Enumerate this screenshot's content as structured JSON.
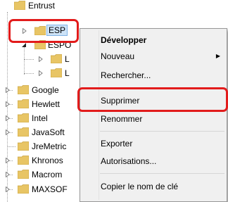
{
  "tree": {
    "nodes": [
      {
        "label": "Entrust"
      },
      {
        "label": "ESP"
      },
      {
        "label": "ESPO"
      },
      {
        "label": "L"
      },
      {
        "label": "L"
      },
      {
        "label": "Google"
      },
      {
        "label": "Hewlett"
      },
      {
        "label": "Intel"
      },
      {
        "label": "JavaSoft"
      },
      {
        "label": "JreMetric"
      },
      {
        "label": "Khronos"
      },
      {
        "label": "Macrom"
      },
      {
        "label": "MAXSOF"
      }
    ]
  },
  "context_menu": {
    "items": [
      {
        "label": "Développer"
      },
      {
        "label": "Nouveau"
      },
      {
        "label": "Rechercher..."
      },
      {
        "label": "Supprimer"
      },
      {
        "label": "Renommer"
      },
      {
        "label": "Exporter"
      },
      {
        "label": "Autorisations..."
      },
      {
        "label": "Copier le nom de clé"
      }
    ]
  },
  "colors": {
    "highlight": "#e21b1b",
    "folder": "#e8c565",
    "selection": "#cde3f7"
  }
}
